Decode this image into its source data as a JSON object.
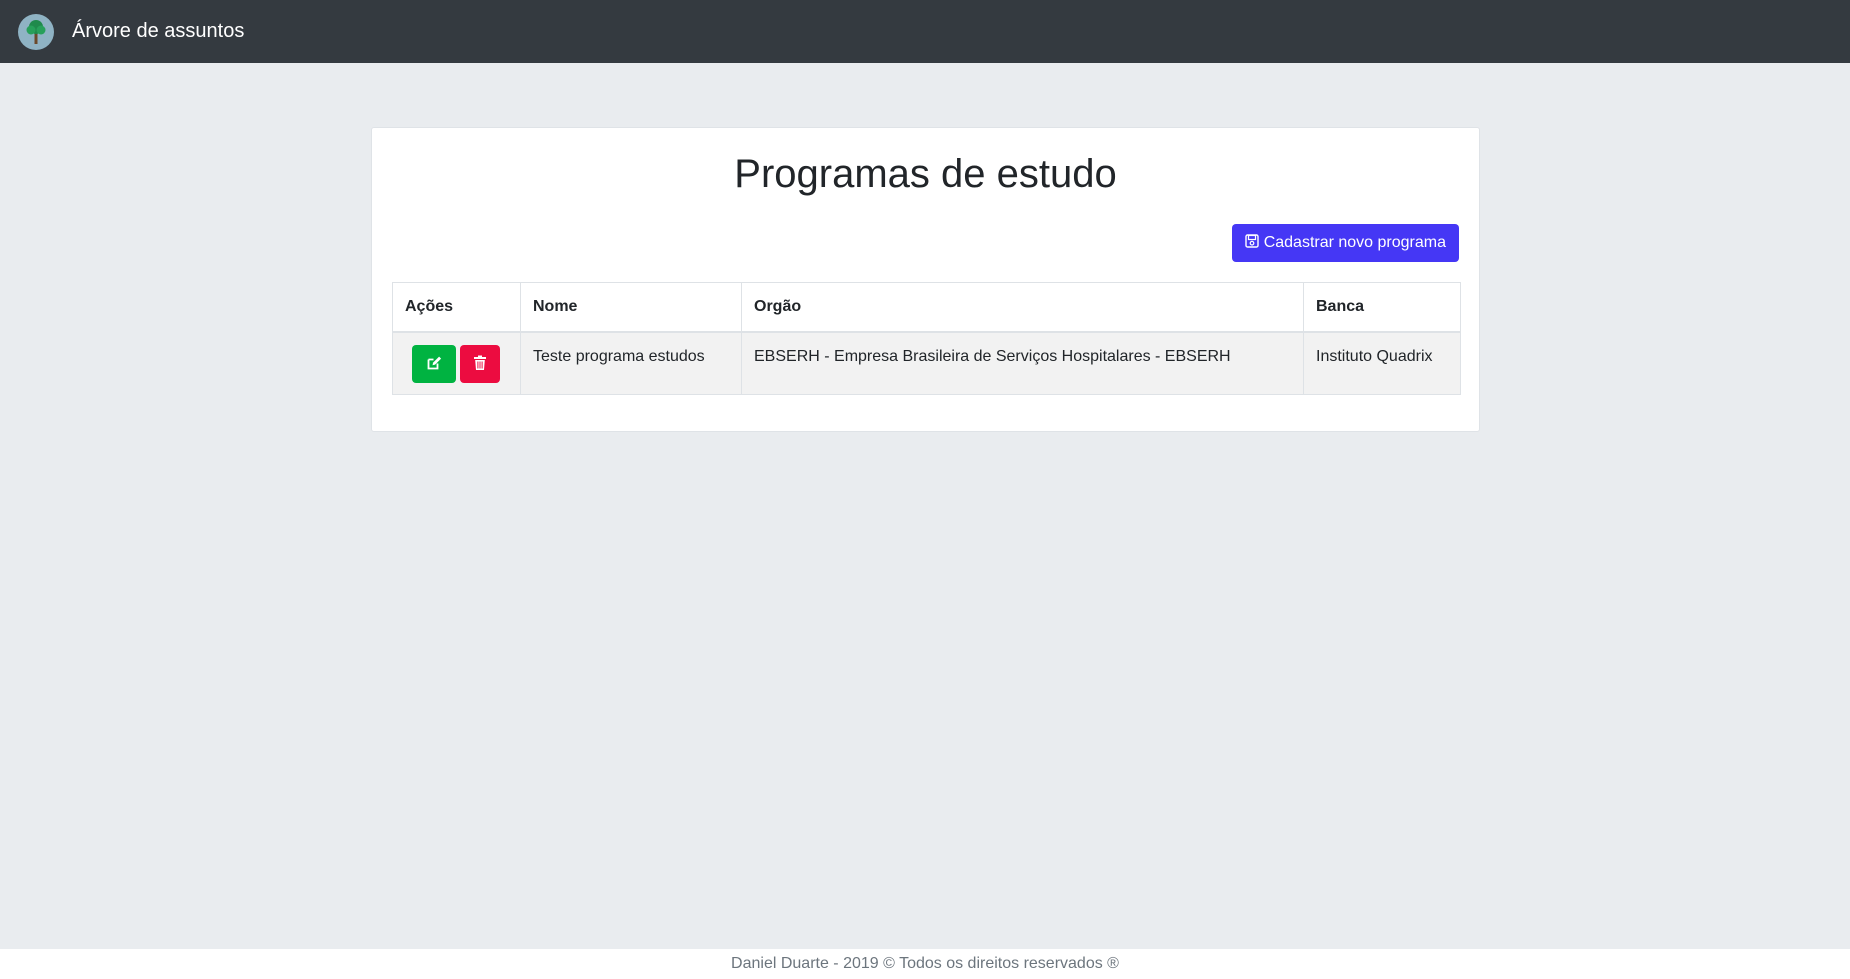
{
  "header": {
    "brand": "Árvore de assuntos",
    "logo_icon": "tree-icon"
  },
  "main": {
    "title": "Programas de estudo",
    "new_button": {
      "label": "Cadastrar novo programa",
      "icon": "save-icon"
    },
    "table": {
      "columns": [
        "Ações",
        "Nome",
        "Orgão",
        "Banca"
      ],
      "rows": [
        {
          "nome": "Teste programa estudos",
          "orgao": "EBSERH - Empresa Brasileira de Serviços Hospitalares - EBSERH",
          "banca": "Instituto Quadrix",
          "actions": [
            "edit-icon",
            "trash-icon"
          ]
        }
      ]
    }
  },
  "footer": {
    "text": "Daniel Duarte - 2019 © Todos os direitos reservados ®"
  },
  "colors": {
    "navbar": "#343a40",
    "background": "#e9ecef",
    "primary": "#4537f5",
    "success": "#00b341",
    "danger": "#ec0c40"
  }
}
